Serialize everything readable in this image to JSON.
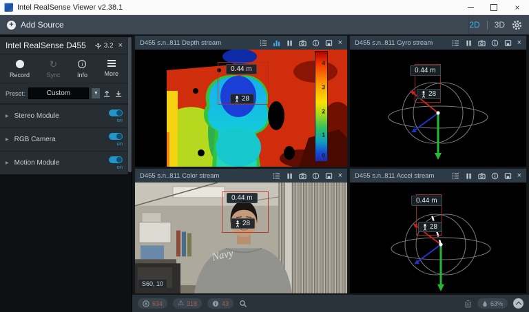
{
  "window": {
    "title": "Intel RealSense Viewer v2.38.1"
  },
  "icons": {
    "plus": "+",
    "close": "×",
    "dropdown": "▼",
    "expander": "▶",
    "sync": "↻",
    "warning": "⚠"
  },
  "colors": {
    "accent_blue": "#3fb3e8",
    "toggle_on": "#2196c9",
    "roi_red": "#b92a1e"
  },
  "toolbar": {
    "add_source": "Add Source",
    "view_2d": "2D",
    "view_3d": "3D"
  },
  "sidebar": {
    "device": {
      "name": "Intel RealSense D455",
      "usb_version": "3.2"
    },
    "actions": {
      "record": "Record",
      "sync": "Sync",
      "info": "Info",
      "more": "More"
    },
    "preset": {
      "label": "Preset:",
      "value": "Custom"
    },
    "modules": [
      {
        "label": "Stereo Module",
        "state": "on"
      },
      {
        "label": "RGB Camera",
        "state": "on"
      },
      {
        "label": "Motion Module",
        "state": "on"
      }
    ]
  },
  "panels": {
    "depth": {
      "title": "D455 s.n..811 Depth stream",
      "distance": "0.44 m",
      "height_value": "28",
      "scale_ticks": [
        "4",
        "3",
        "2",
        "1",
        "0"
      ]
    },
    "color": {
      "title": "D455 s.n..811 Color stream",
      "distance": "0.44 m",
      "height_value": "28",
      "exposure": "S60, 10",
      "shirt_text": "Navy"
    },
    "gyro": {
      "title": "D455 s.n..811 Gyro stream",
      "distance": "0.44 m",
      "height_value": "28"
    },
    "accel": {
      "title": "D455 s.n..811 Accel stream",
      "distance": "0.44 m",
      "height_value": "28"
    }
  },
  "statusbar": {
    "error_count": "634",
    "warning_count": "318",
    "info_count": "43",
    "fill_percent": "63%"
  }
}
